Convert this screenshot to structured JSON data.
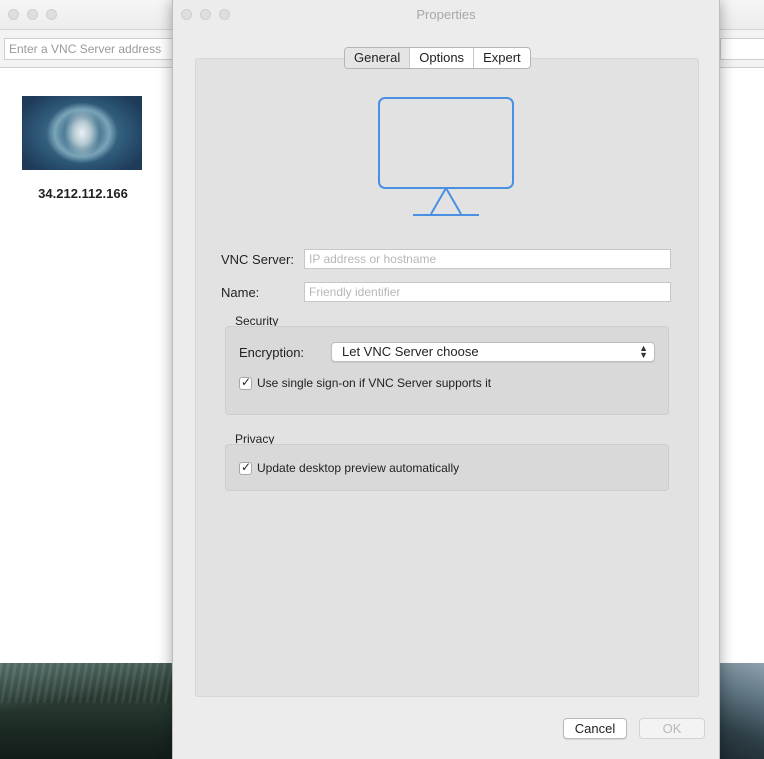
{
  "background_window": {
    "address_placeholder": "Enter a VNC Server address",
    "connection_label": "34.212.112.166"
  },
  "dialog": {
    "title": "Properties",
    "tabs": [
      {
        "label": "General",
        "selected": true
      },
      {
        "label": "Options",
        "selected": false
      },
      {
        "label": "Expert",
        "selected": false
      }
    ],
    "icon": "monitor-icon",
    "vnc_server": {
      "label": "VNC Server:",
      "value": "",
      "placeholder": "IP address or hostname"
    },
    "name": {
      "label": "Name:",
      "value": "",
      "placeholder": "Friendly identifier"
    },
    "security": {
      "title": "Security",
      "encryption_label": "Encryption:",
      "encryption_value": "Let VNC Server choose",
      "sso_label": "Use single sign-on if VNC Server supports it",
      "sso_checked": true
    },
    "privacy": {
      "title": "Privacy",
      "preview_label": "Update desktop preview automatically",
      "preview_checked": true
    },
    "buttons": {
      "cancel": "Cancel",
      "ok": "OK"
    }
  },
  "colors": {
    "accent": "#4a90e2",
    "dialog_bg": "#ececec",
    "panel_bg": "#e2e2e2"
  }
}
